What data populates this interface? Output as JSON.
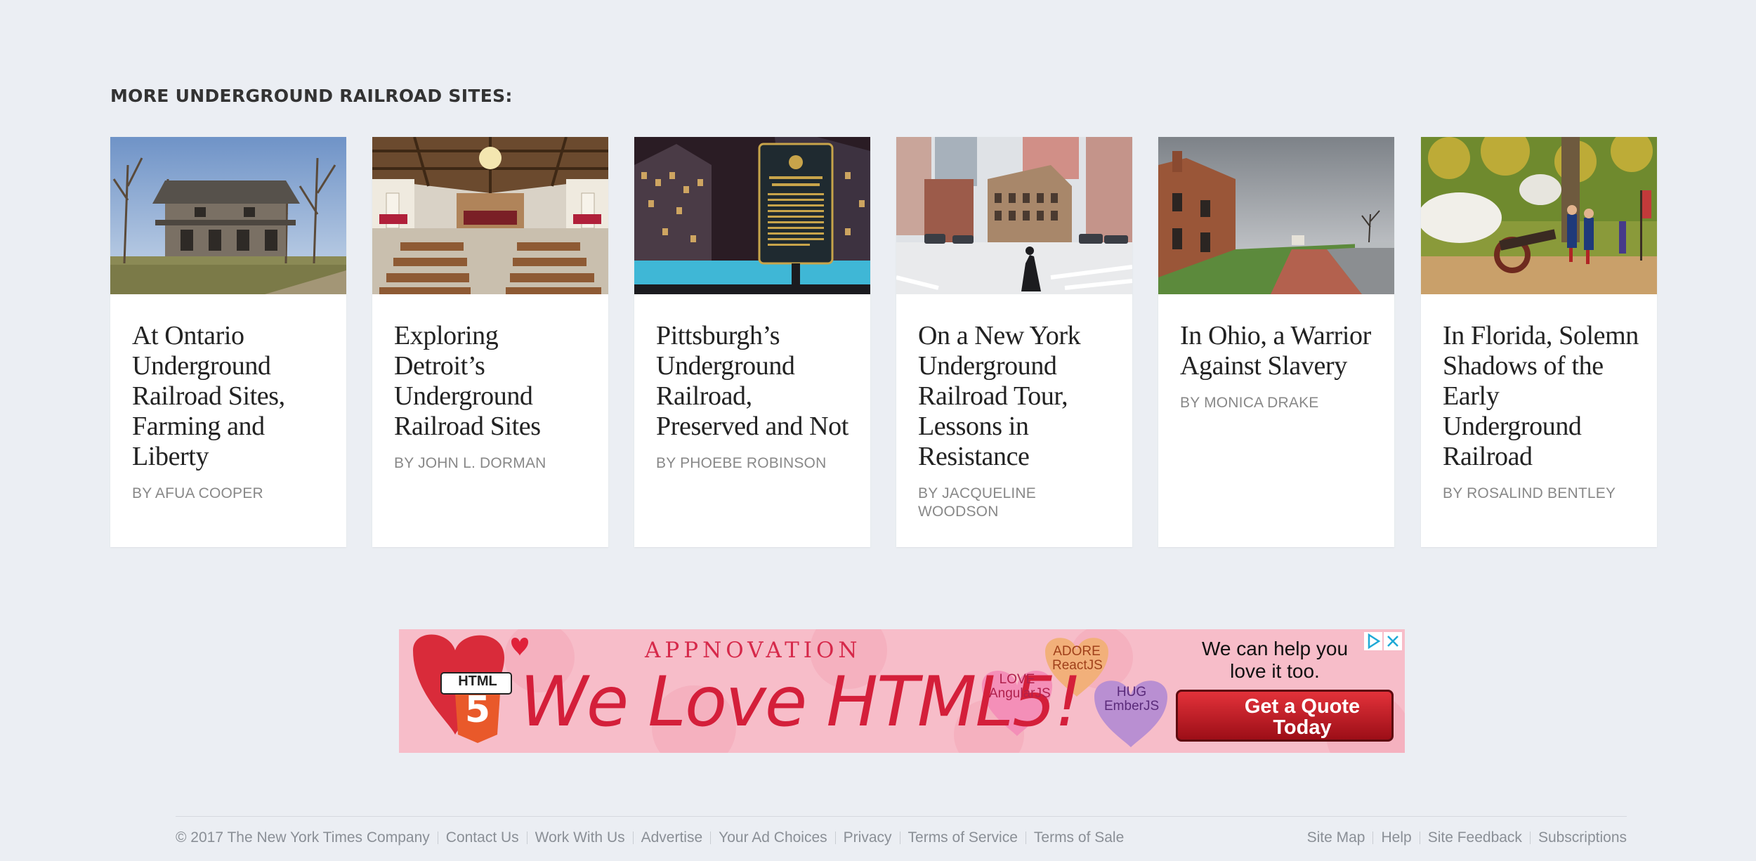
{
  "section": {
    "heading": "MORE UNDERGROUND RAILROAD SITES:"
  },
  "cards": [
    {
      "title": "At Ontario Underground Railroad Sites, Farming and Liberty",
      "byline": "By AFUA COOPER"
    },
    {
      "title": "Exploring Detroit’s Underground Railroad Sites",
      "byline": "By JOHN L. DORMAN"
    },
    {
      "title": "Pittsburgh’s Underground Railroad, Preserved and Not",
      "byline": "By PHOEBE ROBINSON"
    },
    {
      "title": "On a New York Underground Railroad Tour, Lessons in Resistance",
      "byline": "By JACQUELINE WOODSON"
    },
    {
      "title": "In Ohio, a Warrior Against Slavery",
      "byline": "By MONICA DRAKE"
    },
    {
      "title": "In Florida, Solemn Shadows of the Early Underground Railroad",
      "byline": "By ROSALIND BENTLEY"
    }
  ],
  "ad": {
    "brand": "APPNOVATION",
    "headline": "We Love HTML5!",
    "tagline": "We can help you love it too.",
    "cta": "Get a Quote Today",
    "badge": "HTML",
    "hearts": [
      "LOVE AngularJS",
      "ADORE ReactJS",
      "HUG EmberJS"
    ],
    "colors": {
      "background": "#f7bdc9",
      "accent": "#d41f3a"
    }
  },
  "footer": {
    "copyright": "© 2017 The New York Times Company",
    "left_links": [
      "Contact Us",
      "Work With Us",
      "Advertise",
      "Your Ad Choices",
      "Privacy",
      "Terms of Service",
      "Terms of Sale"
    ],
    "right_links": [
      "Site Map",
      "Help",
      "Site Feedback",
      "Subscriptions"
    ]
  }
}
